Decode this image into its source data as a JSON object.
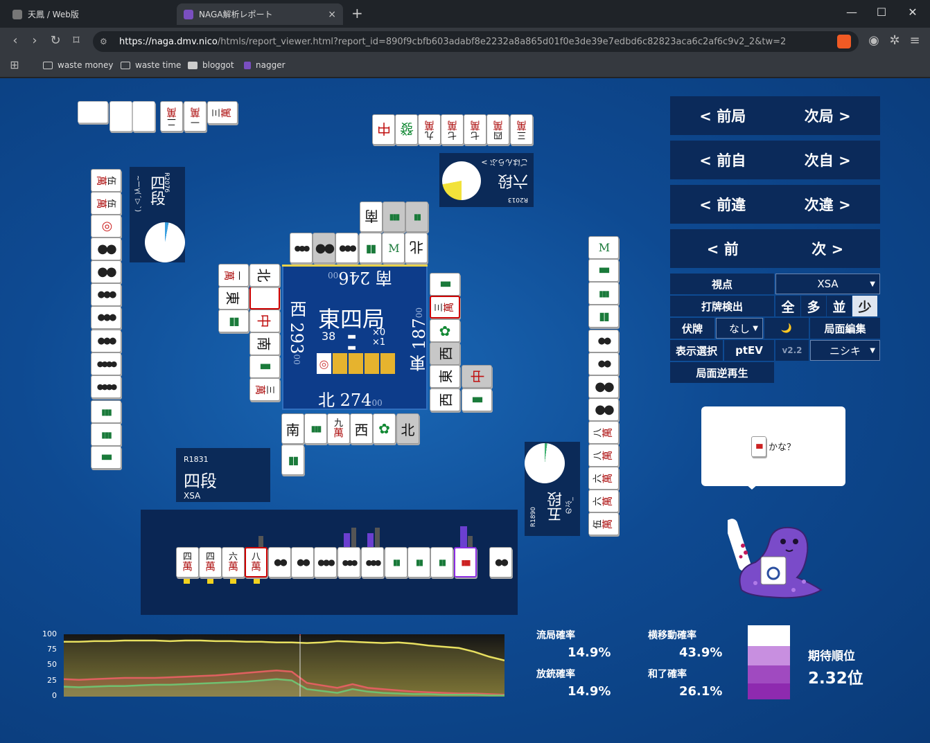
{
  "browser": {
    "tabs": [
      {
        "title": "天鳳 / Web版"
      },
      {
        "title": "NAGA解析レポート",
        "close": "×"
      }
    ],
    "new_tab": "+",
    "window_controls": [
      "—",
      "☐",
      "✕"
    ],
    "url_host": "https://naga.dmv.nico",
    "url_path": "/htmls/report_viewer.html?report_id=890f9cbfb603adabf8e2232a8a865d01f0e3de39e7edbd6c82823aca6c2af6c9v2_2&tw=2",
    "bookmarks": [
      "waste money",
      "waste time",
      "bloggot",
      "nagger"
    ]
  },
  "board": {
    "round": "東四局",
    "honba": "38",
    "sticks": "×0",
    "riichi": "×1",
    "scores": {
      "south": {
        "wind": "北",
        "value": "274",
        "suffix": "00"
      },
      "east": {
        "wind": "東",
        "value": "187",
        "suffix": "00"
      },
      "north": {
        "wind": "南",
        "value": "246",
        "suffix": "00"
      },
      "west": {
        "wind": "西",
        "value": "293",
        "suffix": "00"
      }
    }
  },
  "players": {
    "self": {
      "rating": "R1831",
      "rank": "四段",
      "name": "XSA"
    },
    "right": {
      "rating": "R1890",
      "rank": "五段",
      "name": "のぶ_"
    },
    "top": {
      "rating": "R2013",
      "rank": "六段",
      "name": "ごはんらぶ >"
    },
    "left": {
      "rating": "R2076",
      "rank": "四段",
      "name": "~ーγ(´▽`)"
    }
  },
  "nav": {
    "prev_round": "< 前局",
    "next_round": "次局 >",
    "prev_self": "< 前自",
    "next_self": "次自 >",
    "prev_diff": "< 前違",
    "next_diff": "次違 >",
    "prev": "< 前",
    "next": "次 >",
    "viewpoint_label": "視点",
    "viewpoint_value": "XSA",
    "detect_label": "打牌検出",
    "detect_opts": [
      "全",
      "多",
      "並",
      "少"
    ],
    "hide_label": "伏牌",
    "hide_value": "なし",
    "moon": "🌙",
    "edit": "局面編集",
    "display_label": "表示選択",
    "ptev": "ptEV",
    "version": "v2.2",
    "model": "ニシキ",
    "reverse": "局面逆再生"
  },
  "bubble": {
    "text": "かな？"
  },
  "chart": {
    "y_ticks": [
      "100",
      "75",
      "50",
      "25",
      "0"
    ]
  },
  "chart_data": {
    "type": "line",
    "ylim": [
      0,
      100
    ],
    "series": [
      {
        "color": "#e8e060",
        "values": [
          88,
          88,
          89,
          89,
          90,
          90,
          90,
          89,
          90,
          90,
          89,
          89,
          88,
          88,
          87,
          87,
          86,
          87,
          89,
          88,
          87,
          86,
          87,
          85,
          82,
          80,
          78,
          72,
          64,
          58
        ]
      },
      {
        "color": "#e06060",
        "values": [
          28,
          27,
          28,
          29,
          30,
          30,
          30,
          31,
          32,
          33,
          34,
          36,
          38,
          40,
          42,
          40,
          22,
          18,
          14,
          20,
          14,
          12,
          10,
          8,
          7,
          6,
          5,
          5,
          4,
          3
        ]
      },
      {
        "color": "#70c070",
        "values": [
          16,
          15,
          16,
          17,
          17,
          18,
          19,
          19,
          20,
          21,
          22,
          23,
          24,
          26,
          28,
          26,
          12,
          9,
          6,
          12,
          8,
          6,
          5,
          4,
          4,
          3,
          3,
          3,
          2,
          2
        ]
      }
    ]
  },
  "stats": {
    "ryukyoku_label": "流局確率",
    "ryukyoku": "14.9%",
    "houjuu_label": "放銃確率",
    "houjuu": "14.9%",
    "yoko_label": "横移動確率",
    "yoko": "43.9%",
    "agari_label": "和了確率",
    "agari": "26.1%",
    "rank_label": "期待順位",
    "rank": "2.32位"
  }
}
